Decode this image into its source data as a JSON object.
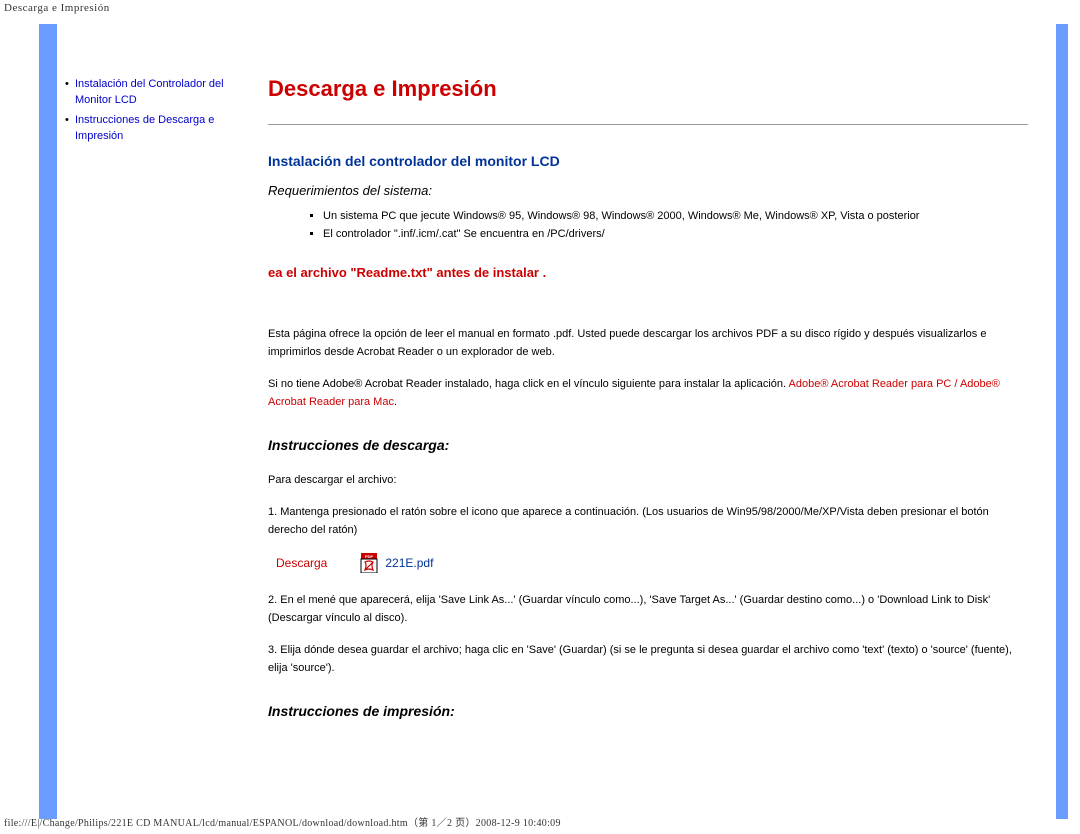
{
  "documentHeader": "Descarga e Impresión",
  "nav": {
    "items": [
      {
        "label": "Instalación del Controlador del Monitor LCD"
      },
      {
        "label": "Instrucciones de Descarga e Impresión"
      }
    ]
  },
  "pageTitle": "Descarga e Impresión",
  "section1": {
    "heading": "Instalación del controlador del monitor LCD",
    "requirementsLabel": "Requerimientos del sistema:",
    "requirements": [
      "Un sistema PC que jecute Windows® 95, Windows® 98, Windows® 2000, Windows® Me, Windows® XP, Vista o posterior",
      "El controlador \".inf/.icm/.cat\" Se encuentra en /PC/drivers/"
    ],
    "readmeWarning": "ea el archivo \"Readme.txt\" antes de instalar ."
  },
  "downloadIntro": {
    "p1": "Esta página ofrece la opción de leer el manual en formato .pdf. Usted puede descargar los archivos PDF a su disco rígido y después visualizarlos e imprimirlos desde Acrobat Reader o un explorador de web.",
    "p2_a": "Si no tiene Adobe® Acrobat Reader instalado, haga click en el vínculo siguiente para instalar la aplicación. ",
    "p2_link1": "Adobe® Acrobat Reader para PC",
    "p2_sep": " / ",
    "p2_link2": "Adobe® Acrobat Reader para Mac",
    "p2_end": "."
  },
  "section2": {
    "heading": "Instrucciones de descarga:",
    "p1": "Para descargar el archivo:",
    "step1": "1. Mantenga presionado el ratón sobre el icono que aparece a continuación. (Los usuarios de Win95/98/2000/Me/XP/Vista deben presionar el botón derecho del ratón)",
    "downloadLabel": "Descarga",
    "downloadFile": "221E.pdf",
    "step2": "2. En el mené que aparecerá, elija 'Save Link As...' (Guardar vínculo como...), 'Save Target As...' (Guardar destino como...) o 'Download Link to Disk' (Descargar vínculo al disco).",
    "step3": "3. Elija dónde desea guardar el archivo; haga clic en 'Save' (Guardar) (si se le pregunta si desea guardar el archivo como 'text' (texto) o 'source' (fuente), elija 'source')."
  },
  "section3": {
    "heading": "Instrucciones de impresión:"
  },
  "footer": "file:///E|/Change/Philips/221E CD MANUAL/lcd/manual/ESPANOL/download/download.htm（第 1／2 页）2008-12-9 10:40:09"
}
